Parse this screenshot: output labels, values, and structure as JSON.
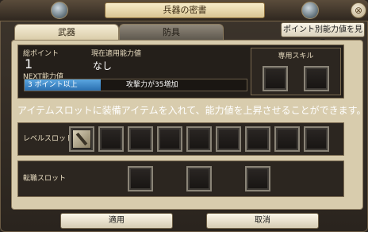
{
  "window": {
    "title": "兵器の密書",
    "close_glyph": "⊗"
  },
  "tabs": [
    {
      "label": "武器",
      "active": true
    },
    {
      "label": "防具",
      "active": false
    }
  ],
  "point_button": "ポイント別能力値を見る",
  "info": {
    "total_points_label": "総ポイント",
    "total_points_value": "1",
    "current_label": "現在適用能力値",
    "current_value": "なし",
    "next_label": "NEXT能力値",
    "next_condition": "3 ポイント以上",
    "next_effect": "攻撃力が35増加"
  },
  "skill": {
    "title": "専用スキル"
  },
  "description": "アイテムスロットに装備アイテムを入れて、能力値を上昇させることができます。",
  "level_slot": {
    "label": "レベルスロット",
    "filled_icon": "sword-icon"
  },
  "job_slot": {
    "label": "転職スロット"
  },
  "footer": {
    "apply": "適用",
    "cancel": "取消"
  },
  "colors": {
    "accent_blue": "#3a86cc",
    "panel_bg": "#d8ccad",
    "dark_bg": "#241f1a"
  }
}
